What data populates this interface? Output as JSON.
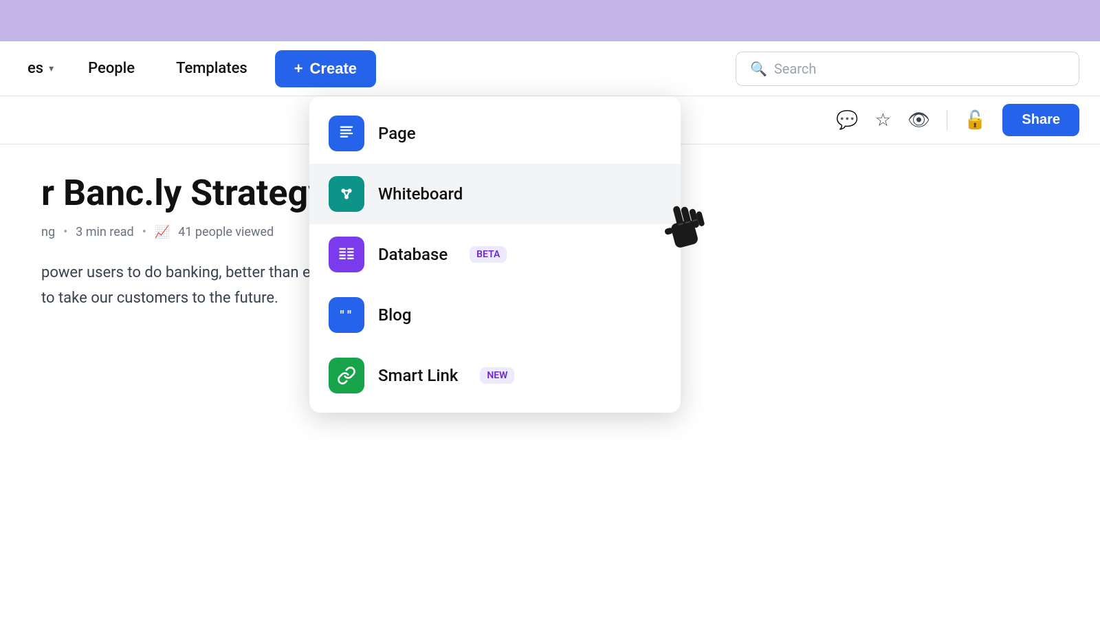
{
  "topBanner": {},
  "navbar": {
    "pages_label": "es",
    "people_label": "People",
    "templates_label": "Templates",
    "create_label": "Create",
    "search_placeholder": "Search"
  },
  "toolbar": {
    "share_label": "Share"
  },
  "page": {
    "title": "r Banc.ly Strategy",
    "meta_author": "ng",
    "meta_read_time": "3 min read",
    "meta_views": "41 people viewed",
    "body_line1": "power users to do banking, better than ever. We are a credit card company",
    "body_line2": "to take our customers to the future."
  },
  "dropdown": {
    "items": [
      {
        "id": "page",
        "label": "Page",
        "icon_type": "page",
        "badge": null
      },
      {
        "id": "whiteboard",
        "label": "Whiteboard",
        "icon_type": "whiteboard",
        "badge": null
      },
      {
        "id": "database",
        "label": "Database",
        "icon_type": "database",
        "badge": "BETA",
        "badge_class": "badge-beta"
      },
      {
        "id": "blog",
        "label": "Blog",
        "icon_type": "blog",
        "badge": null
      },
      {
        "id": "smartlink",
        "label": "Smart Link",
        "icon_type": "smartlink",
        "badge": "NEW",
        "badge_class": "badge-new"
      }
    ]
  }
}
